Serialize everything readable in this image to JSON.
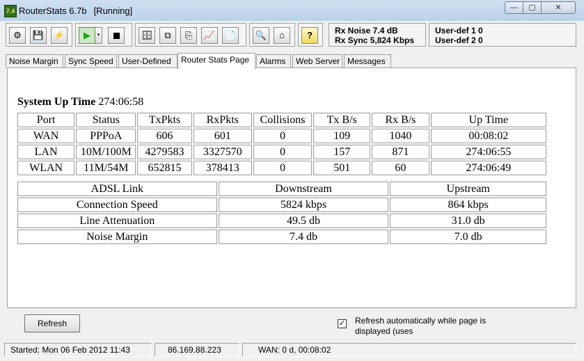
{
  "window": {
    "icon_text": "7.4",
    "title": "RouterStats 6.7b",
    "status": "[Running]",
    "min_glyph": "—",
    "max_glyph": "▢",
    "close_glyph": "✕"
  },
  "toolbar": {
    "buttons": [
      {
        "name": "settings-icon",
        "glyph": "⚙"
      },
      {
        "name": "save-icon",
        "glyph": "💾"
      },
      {
        "name": "connect-icon",
        "glyph": "⚡"
      },
      {
        "name": "play-icon",
        "glyph": "▶"
      },
      {
        "name": "dropdown-icon",
        "glyph": "▾"
      },
      {
        "name": "stop-icon",
        "glyph": ""
      },
      {
        "name": "database-icon",
        "glyph": "🗄"
      },
      {
        "name": "copy-icon",
        "glyph": "⧉"
      },
      {
        "name": "export-icon",
        "glyph": "⎘"
      },
      {
        "name": "graph-icon",
        "glyph": "📈"
      },
      {
        "name": "report-icon",
        "glyph": "📄"
      },
      {
        "name": "preview-icon",
        "glyph": "🔍"
      },
      {
        "name": "home-icon",
        "glyph": "⌂"
      },
      {
        "name": "help-icon",
        "glyph": "?"
      }
    ],
    "rx_noise": "Rx Noise 7.4 dB",
    "rx_sync": "Rx Sync  5,824 Kbps",
    "user_def_1": "User-def 1  0",
    "user_def_2": "User-def 2  0"
  },
  "tabs": [
    {
      "label": "Noise Margin"
    },
    {
      "label": "Sync Speed"
    },
    {
      "label": "User-Defined"
    },
    {
      "label": "Router Stats Page"
    },
    {
      "label": "Alarms"
    },
    {
      "label": "Web Server"
    },
    {
      "label": "Messages"
    }
  ],
  "active_tab": "Router Stats Page",
  "content": {
    "uptime_label": "System Up Time",
    "uptime_value": "274:06:58",
    "ports_table": {
      "headers": [
        "Port",
        "Status",
        "TxPkts",
        "RxPkts",
        "Collisions",
        "Tx B/s",
        "Rx B/s",
        "Up Time"
      ],
      "rows": [
        [
          "WAN",
          "PPPoA",
          "606",
          "601",
          "0",
          "109",
          "1040",
          "00:08:02"
        ],
        [
          "LAN",
          "10M/100M",
          "4279583",
          "3327570",
          "0",
          "157",
          "871",
          "274:06:55"
        ],
        [
          "WLAN",
          "11M/54M",
          "652815",
          "378413",
          "0",
          "501",
          "60",
          "274:06:49"
        ]
      ]
    },
    "adsl_table": {
      "headers": [
        "ADSL Link",
        "Downstream",
        "Upstream"
      ],
      "rows": [
        [
          "Connection Speed",
          "5824 kbps",
          "864 kbps"
        ],
        [
          "Line Attenuation",
          "49.5 db",
          "31.0 db"
        ],
        [
          "Noise Margin",
          "7.4 db",
          "7.0 db"
        ]
      ]
    }
  },
  "bottom": {
    "refresh_label": "Refresh",
    "auto_refresh_checked_glyph": "✓",
    "auto_refresh_label": "Refresh automatically while page is displayed (uses"
  },
  "statusbar": {
    "started": "Started: Mon 06 Feb 2012   11:43",
    "ip": "86.169.88.223",
    "wan": "WAN: 0 d, 00:08:02"
  }
}
